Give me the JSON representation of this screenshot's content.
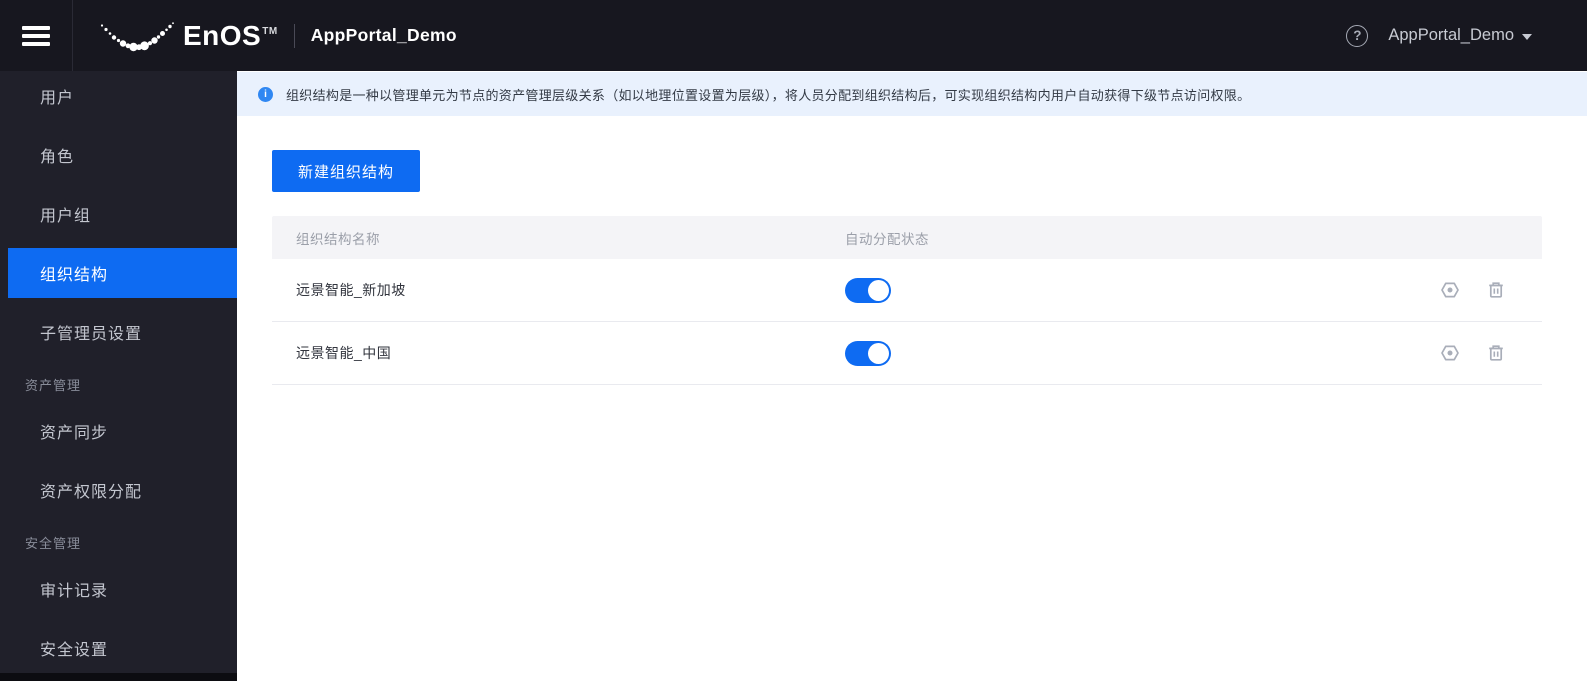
{
  "topbar": {
    "brand": "EnOS",
    "brand_tm": "TM",
    "app_title": "AppPortal_Demo",
    "help_glyph": "?",
    "account_name": "AppPortal_Demo",
    "icons": [
      "hamburger-icon",
      "enos-crescent-logo",
      "help-circle-icon",
      "caret-down-icon"
    ]
  },
  "sidebar": {
    "items": [
      {
        "label": "用户",
        "type": "item",
        "active": false
      },
      {
        "label": "角色",
        "type": "item",
        "active": false
      },
      {
        "label": "用户组",
        "type": "item",
        "active": false
      },
      {
        "label": "组织结构",
        "type": "item",
        "active": true
      },
      {
        "label": "子管理员设置",
        "type": "item",
        "active": false
      },
      {
        "label": "资产管理",
        "type": "section"
      },
      {
        "label": "资产同步",
        "type": "item",
        "active": false
      },
      {
        "label": "资产权限分配",
        "type": "item",
        "active": false
      },
      {
        "label": "安全管理",
        "type": "section"
      },
      {
        "label": "审计记录",
        "type": "item",
        "active": false
      },
      {
        "label": "安全设置",
        "type": "item",
        "active": false
      }
    ]
  },
  "banner": {
    "info_glyph": "i",
    "text": "组织结构是一种以管理单元为节点的资产管理层级关系（如以地理位置设置为层级），将人员分配到组织结构后，可实现组织结构内用户自动获得下级节点访问权限。"
  },
  "main": {
    "create_button_label": "新建组织结构",
    "table": {
      "columns": [
        "组织结构名称",
        "自动分配状态"
      ],
      "rows": [
        {
          "name": "远景智能_新加坡",
          "auto_assign_on": true
        },
        {
          "name": "远景智能_中国",
          "auto_assign_on": true
        }
      ],
      "row_action_icons": [
        "settings-nut-icon",
        "trash-icon"
      ]
    }
  },
  "colors": {
    "topbar_bg": "#17171f",
    "sidebar_bg": "#20202a",
    "primary_blue": "#0e6bf2",
    "banner_bg": "#e9f1fd",
    "info_icon_blue": "#2f87f2",
    "table_header_bg": "#f4f4f7",
    "header_text": "#9b9fa9",
    "row_text": "#32353e",
    "icon_gray": "#a9aeb9"
  }
}
